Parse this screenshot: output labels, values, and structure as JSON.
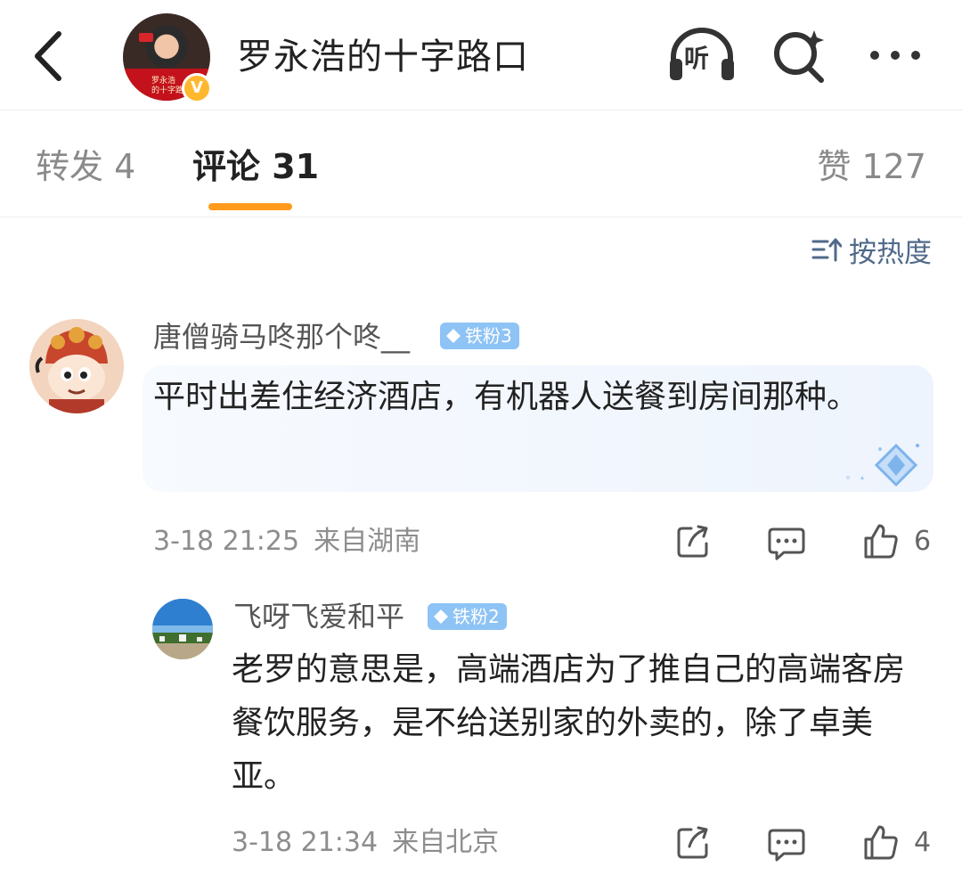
{
  "header": {
    "title": "罗永浩的十字路口",
    "avatar_text": "罗永浩\n的十字路口",
    "verified_mark": "V",
    "listen_label": "听"
  },
  "tabs": {
    "repost": "转发 4",
    "comment": "评论 31",
    "like": "赞 127"
  },
  "sort": {
    "label": "按热度"
  },
  "comments": [
    {
      "username": "唐僧骑马咚那个咚__",
      "badge": "铁粉3",
      "text": "平时出差住经济酒店，有机器人送餐到房间那种。",
      "date": "3-18 21:25",
      "location": "来自湖南",
      "likes": "6"
    },
    {
      "username": "飞呀飞爱和平",
      "badge": "铁粉2",
      "text": "老罗的意思是，高端酒店为了推自己的高端客房餐饮服务，是不给送别家的外卖的，除了卓美亚。",
      "date": "3-18 21:34",
      "location": "来自北京",
      "likes": "4"
    }
  ],
  "colors": {
    "tab_indicator": "#ff9b1a",
    "badge": "#8ec3f5",
    "sort_text": "#506a8a",
    "verified": "#ffb82e"
  }
}
